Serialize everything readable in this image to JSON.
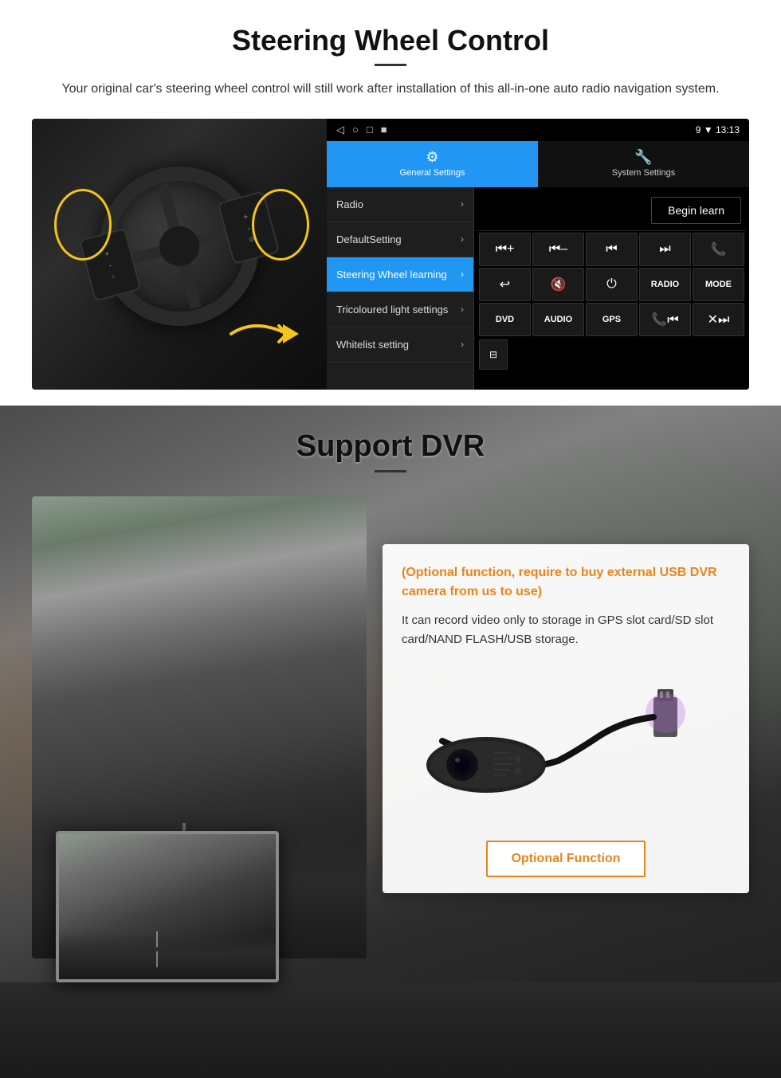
{
  "page": {
    "title": "Steering Wheel Control"
  },
  "steering": {
    "title": "Steering Wheel Control",
    "subtitle": "Your original car's steering wheel control will still work after installation of this all-in-one auto radio navigation system.",
    "statusbar": {
      "time": "13:13",
      "signal": "▼",
      "icons": [
        "◁",
        "○",
        "□",
        "■"
      ]
    },
    "tabs": [
      {
        "label": "General Settings",
        "active": true
      },
      {
        "label": "System Settings",
        "active": false
      }
    ],
    "menu_items": [
      {
        "label": "Radio",
        "active": false
      },
      {
        "label": "DefaultSetting",
        "active": false
      },
      {
        "label": "Steering Wheel learning",
        "active": true
      },
      {
        "label": "Tricoloured light settings",
        "active": false
      },
      {
        "label": "Whitelist setting",
        "active": false
      }
    ],
    "begin_learn": "Begin learn",
    "control_buttons": [
      {
        "label": "⏮+",
        "type": "icon"
      },
      {
        "label": "⏮-",
        "type": "icon"
      },
      {
        "label": "⏮",
        "type": "icon"
      },
      {
        "label": "⏭",
        "type": "icon"
      },
      {
        "label": "📞",
        "type": "icon"
      },
      {
        "label": "↩",
        "type": "icon"
      },
      {
        "label": "🔇",
        "type": "icon"
      },
      {
        "label": "⏻",
        "type": "icon"
      },
      {
        "label": "RADIO",
        "type": "label"
      },
      {
        "label": "MODE",
        "type": "label"
      },
      {
        "label": "DVD",
        "type": "label"
      },
      {
        "label": "AUDIO",
        "type": "label"
      },
      {
        "label": "GPS",
        "type": "label"
      },
      {
        "label": "📞⏮",
        "type": "icon"
      },
      {
        "label": "✕⏭",
        "type": "icon"
      }
    ],
    "extra_btn": {
      "label": "⊟"
    }
  },
  "dvr": {
    "title": "Support DVR",
    "optional_heading": "(Optional function, require to buy external USB DVR camera from us to use)",
    "description": "It can record video only to storage in GPS slot card/SD slot card/NAND FLASH/USB storage.",
    "optional_button": "Optional Function"
  }
}
